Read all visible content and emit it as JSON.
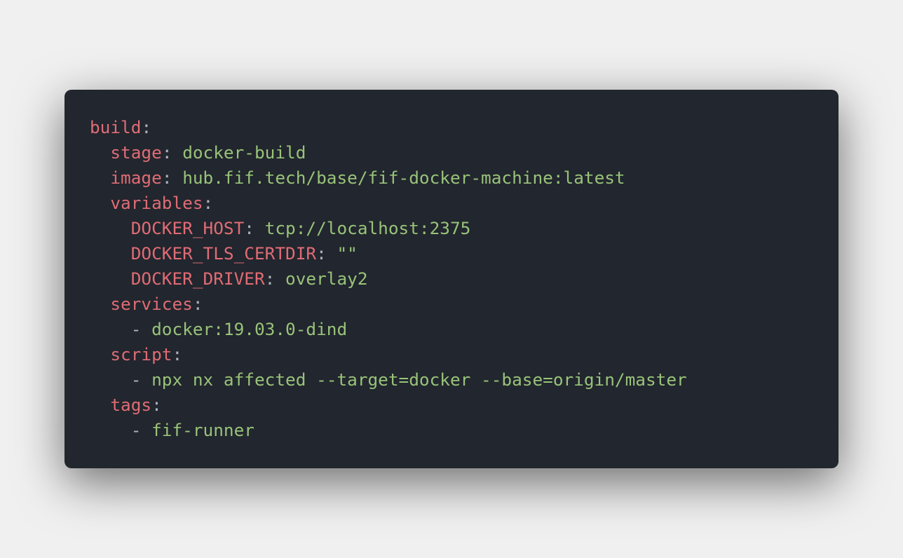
{
  "colors": {
    "background": "#f0f0f0",
    "editor_bg": "#22262e",
    "key": "#e06c75",
    "punctuation": "#abb2bf",
    "string": "#98c379"
  },
  "code_lines": [
    {
      "indent": "",
      "key": "build",
      "sep": ":",
      "value": ""
    },
    {
      "indent": "  ",
      "key": "stage",
      "sep": ": ",
      "value": "docker-build"
    },
    {
      "indent": "  ",
      "key": "image",
      "sep": ": ",
      "value": "hub.fif.tech/base/fif-docker-machine:latest"
    },
    {
      "indent": "  ",
      "key": "variables",
      "sep": ":",
      "value": ""
    },
    {
      "indent": "    ",
      "key": "DOCKER_HOST",
      "sep": ": ",
      "value": "tcp://localhost:2375"
    },
    {
      "indent": "    ",
      "key": "DOCKER_TLS_CERTDIR",
      "sep": ": ",
      "value": "\"\""
    },
    {
      "indent": "    ",
      "key": "DOCKER_DRIVER",
      "sep": ": ",
      "value": "overlay2"
    },
    {
      "indent": "  ",
      "key": "services",
      "sep": ":",
      "value": ""
    },
    {
      "indent": "    ",
      "key": "",
      "sep": "- ",
      "value": "docker:19.03.0-dind"
    },
    {
      "indent": "  ",
      "key": "script",
      "sep": ":",
      "value": ""
    },
    {
      "indent": "    ",
      "key": "",
      "sep": "- ",
      "value": "npx nx affected --target=docker --base=origin/master"
    },
    {
      "indent": "  ",
      "key": "tags",
      "sep": ":",
      "value": ""
    },
    {
      "indent": "    ",
      "key": "",
      "sep": "- ",
      "value": "fif-runner"
    }
  ]
}
